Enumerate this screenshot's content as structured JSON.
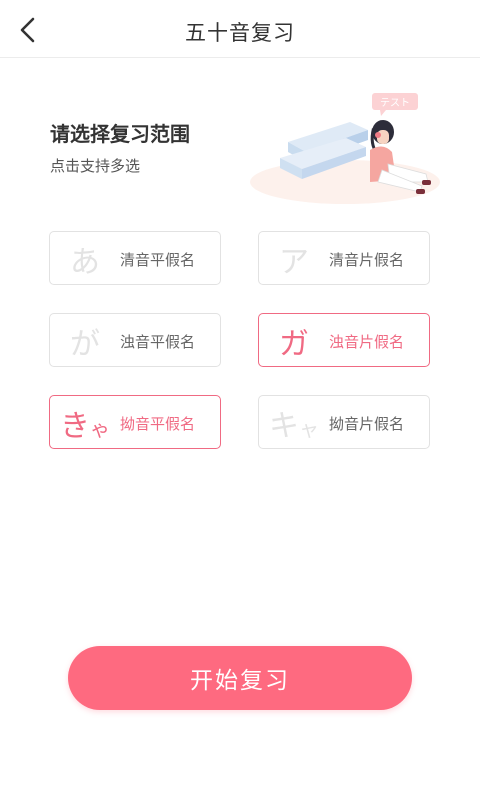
{
  "header": {
    "title": "五十音复习",
    "back_icon": "chevron-left-icon"
  },
  "intro": {
    "title": "请选择复习范围",
    "subtitle": "点击支持多选",
    "illustration_tag": "テスト"
  },
  "options": [
    {
      "kana": "あ",
      "kana_small": "",
      "label": "清音平假名",
      "selected": false
    },
    {
      "kana": "ア",
      "kana_small": "",
      "label": "清音片假名",
      "selected": false
    },
    {
      "kana": "が",
      "kana_small": "",
      "label": "浊音平假名",
      "selected": false
    },
    {
      "kana": "ガ",
      "kana_small": "",
      "label": "浊音片假名",
      "selected": true
    },
    {
      "kana": "き",
      "kana_small": "ゃ",
      "label": "拗音平假名",
      "selected": true
    },
    {
      "kana": "キ",
      "kana_small": "ャ",
      "label": "拗音片假名",
      "selected": false
    }
  ],
  "start_button": {
    "label": "开始复习"
  },
  "colors": {
    "accent": "#fe6a80",
    "selected_border": "#f06a83",
    "unselected_border": "#e2e2e2",
    "unselected_kana": "#e3e3e3"
  }
}
